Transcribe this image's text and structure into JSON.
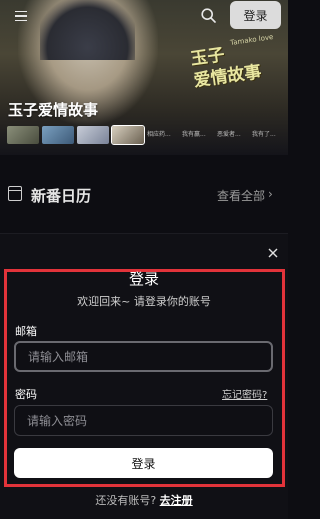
{
  "topbar": {
    "login_label": "登录"
  },
  "hero": {
    "title": "玉子爱情故事",
    "art_title": "玉子\n爱情故事",
    "art_sub": "Tamako love"
  },
  "thumbnails": [
    {
      "caption": ""
    },
    {
      "caption": ""
    },
    {
      "caption": ""
    },
    {
      "caption": ""
    },
    {
      "caption": "相应药..."
    },
    {
      "caption": "我有赢..."
    },
    {
      "caption": "恶爱者..."
    },
    {
      "caption": "我有了..."
    }
  ],
  "calendar": {
    "title": "新番日历",
    "view_all": "查看全部",
    "chevron": "›"
  },
  "login_modal": {
    "title": "登录",
    "subtitle": "欢迎回来~ 请登录你的账号",
    "email_label": "邮箱",
    "email_placeholder": "请输入邮箱",
    "email_value": "",
    "password_label": "密码",
    "password_placeholder": "请输入密码",
    "password_value": "",
    "forgot_label": "忘记密码?",
    "submit_label": "登录",
    "register_prompt": "还没有账号?",
    "register_link": "去注册",
    "highlight_color": "#e2333a"
  }
}
